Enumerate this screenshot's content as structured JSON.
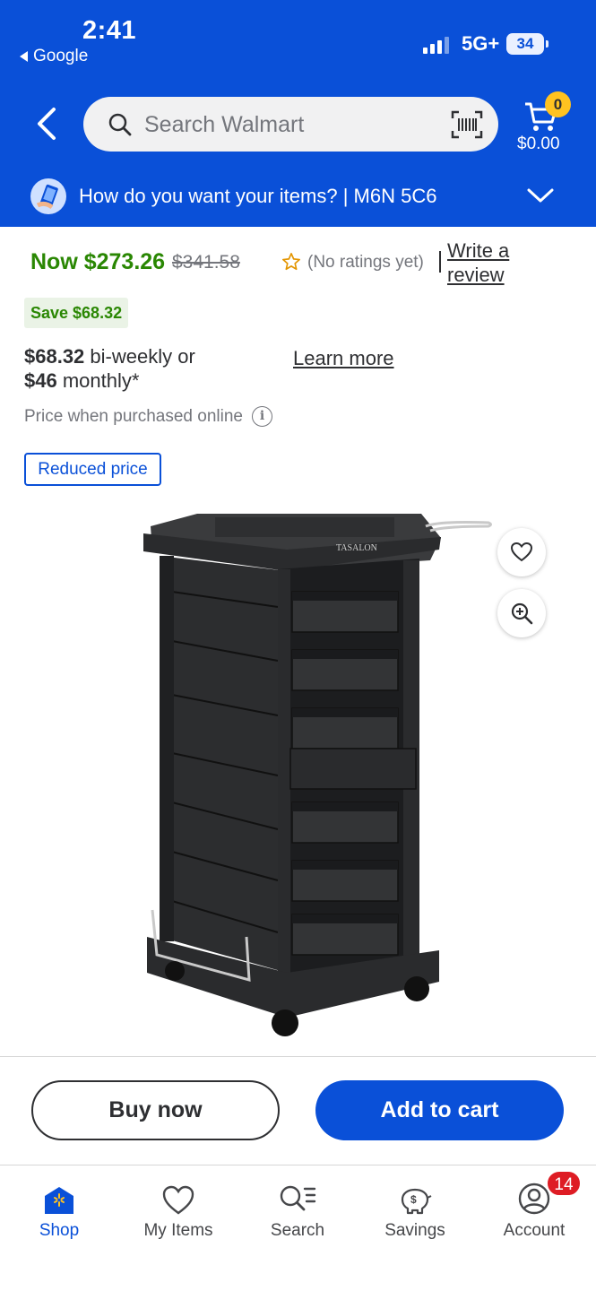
{
  "status_bar": {
    "time": "2:41",
    "back_app": "Google",
    "network": "5G+",
    "battery": "34"
  },
  "header": {
    "search_placeholder": "Search Walmart",
    "cart_count": "0",
    "cart_total": "$0.00",
    "fulfillment_text": "How do you want your items? | M6N 5C6"
  },
  "price": {
    "now": "Now $273.26",
    "was": "$341.58",
    "rating_text": "(No ratings yet)",
    "write_review": "Write a review",
    "save": "Save $68.32",
    "installment_biweekly_amount": "$68.32",
    "installment_biweekly_text": " bi-weekly or",
    "installment_monthly_amount": "$46",
    "installment_monthly_text": " monthly*",
    "learn_more": "Learn more",
    "online_note": "Price when purchased online",
    "reduced_badge": "Reduced price"
  },
  "product": {
    "brand_marking": "TASALON"
  },
  "actions": {
    "buy_now": "Buy now",
    "add_to_cart": "Add to cart"
  },
  "bottom_nav": {
    "items": [
      {
        "label": "Shop",
        "icon": "shop-icon"
      },
      {
        "label": "My Items",
        "icon": "heart-icon"
      },
      {
        "label": "Search",
        "icon": "search-list-icon"
      },
      {
        "label": "Savings",
        "icon": "piggy-bank-icon"
      },
      {
        "label": "Account",
        "icon": "account-icon"
      }
    ],
    "account_badge": "14"
  },
  "colors": {
    "brand_blue": "#0a50d8",
    "price_green": "#2a8703",
    "cart_badge": "#ffc220",
    "alert_red": "#de1c24"
  }
}
